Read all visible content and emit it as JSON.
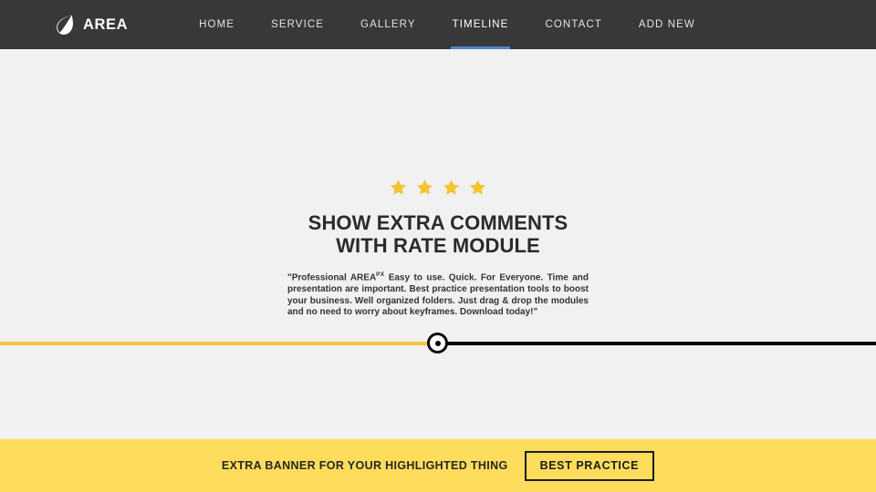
{
  "header": {
    "brand": {
      "name": "AREA",
      "logo_icon": "leaf-icon"
    },
    "nav": [
      {
        "label": "HOME",
        "active": false
      },
      {
        "label": "SERVICE",
        "active": false
      },
      {
        "label": "GALLERY",
        "active": false
      },
      {
        "label": "TIMELINE",
        "active": true
      },
      {
        "label": "CONTACT",
        "active": false
      },
      {
        "label": "ADD NEW",
        "active": false
      }
    ]
  },
  "hero": {
    "rating": {
      "icon": "star-icon",
      "count": 4
    },
    "title_line1": "SHOW EXTRA COMMENTS",
    "title_line2": "WITH RATE MODULE",
    "copy_before": "\"Professional AREA",
    "copy_superscript": "PX",
    "copy_after": " Easy to use. Quick. For Everyone. Time and presentation are important. Best practice presentation tools to boost your business. Well organized folders. Just drag & drop the modules and no need to worry about keyframes. Download today!\""
  },
  "timeline": {
    "marker_icon": "timeline-node-icon",
    "left_color": "#f2c83c",
    "right_color": "#060606"
  },
  "banner": {
    "text": "EXTRA BANNER FOR YOUR HIGHLIGHTED THING",
    "button_label": "BEST PRACTICE",
    "background": "#ffdd5c"
  },
  "colors": {
    "header_bg": "#383838",
    "page_bg": "#f1f1f1",
    "accent_blue": "#4a86c8",
    "accent_yellow": "#f2c83c",
    "star_gold": "#f5c431"
  }
}
